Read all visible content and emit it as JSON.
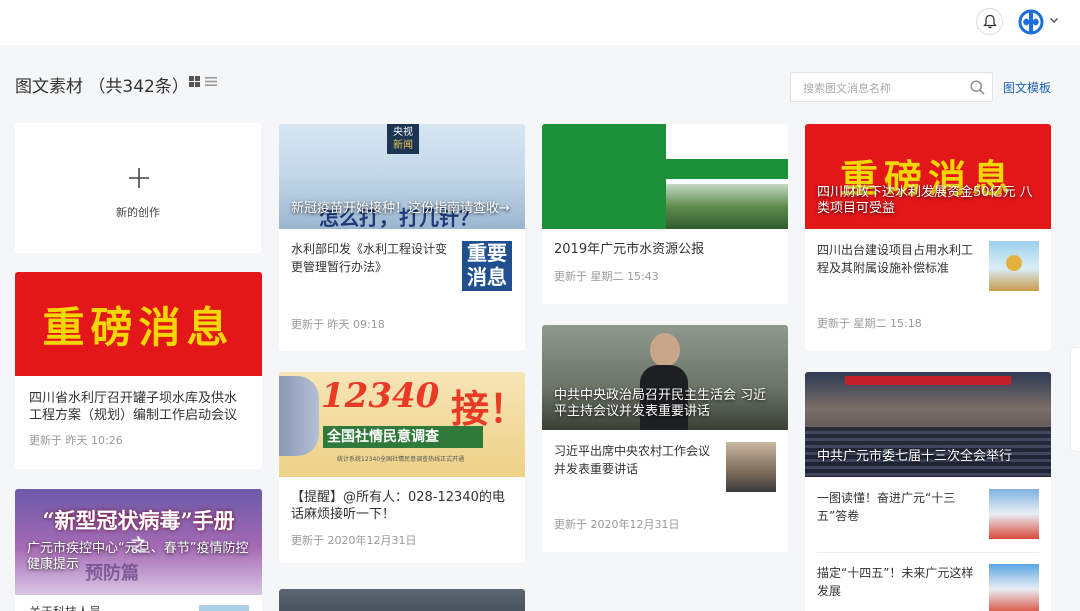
{
  "header": {
    "bell_icon": "bell-icon",
    "avatar_icon": "brand-logo-avatar",
    "caret_icon": "chevron-down-icon"
  },
  "toolbar": {
    "title": "图文素材 （共342条）",
    "grid_view_icon": "grid-view-icon",
    "list_view_icon": "list-view-icon",
    "search_placeholder": "搜索图文消息名称",
    "template_link": "图文模板"
  },
  "new_card": {
    "label": "新的创作",
    "icon": "plus-icon"
  },
  "cards": {
    "c1": {
      "banner": "重磅消息",
      "title": "四川省水利厅召开罐子坝水库及供水工程方案（规划）编制工作启动会议",
      "time": "更新于 昨天 10:26"
    },
    "c2": {
      "cover_caption": "广元市疾控中心“元旦、春节”疫情防控健康提示",
      "banner_line1": "“新型冠状病毒”手册",
      "banner_line2": "之",
      "banner_line3": "预防篇",
      "next_title": "关于科技人员…"
    },
    "c3": {
      "badge1": "央视",
      "badge2": "新闻",
      "cover_text": "怎么打，打几针？",
      "cover_caption": "新冠疫苗开始接种！这份指南请查收→",
      "sub_title": "水利部印发《水利工程设计变更管理暂行办法》",
      "thumb_line1": "重要",
      "thumb_line2": "消息",
      "time": "更新于 昨天 09:18"
    },
    "c4": {
      "cover_num": "12340",
      "cover_jie": "接！",
      "cover_band": "全国社情民意调查",
      "cover_small": "统计系统12340全国社情民意调查热线正式开通",
      "title": "【提醒】@所有人：028-12340的电话麻烦接听一下！",
      "time": "更新于 2020年12月31日"
    },
    "c6": {
      "title": "2019年广元市水资源公报",
      "time": "更新于 星期二 15:43"
    },
    "c7": {
      "cover_caption": "中共中央政治局召开民主生活会 习近平主持会议并发表重要讲话",
      "sub_title": "习近平出席中央农村工作会议并发表重要讲话",
      "time": "更新于 2020年12月31日"
    },
    "c8": {
      "banner": "重磅消息",
      "cover_caption": "四川财政下达水利发展资金50亿元 八类项目可受益",
      "sub_title": "四川出台建设项目占用水利工程及其附属设施补偿标准",
      "time": "更新于 星期二 15:18"
    },
    "c9": {
      "cover_caption": "中共广元市委七届十三次全会举行",
      "sub1": "一图读懂！奋进广元“十三五”答卷",
      "sub2": "描定“十四五”！未来广元这样发展"
    }
  },
  "colors": {
    "accent": "#1a5fb4",
    "banner_red": "#e3161a",
    "banner_yellow": "#f5d700"
  }
}
